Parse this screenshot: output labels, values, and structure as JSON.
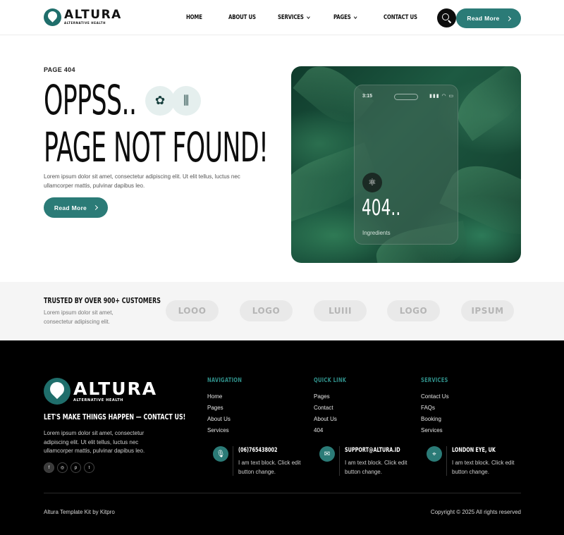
{
  "brand": {
    "name": "ALTURA",
    "tagline": "ALTERNATIVE HEALTH"
  },
  "nav": {
    "items": [
      {
        "label": "HOME",
        "has_dropdown": false
      },
      {
        "label": "ABOUT US",
        "has_dropdown": false
      },
      {
        "label": "SERVICES",
        "has_dropdown": true
      },
      {
        "label": "PAGES",
        "has_dropdown": true
      },
      {
        "label": "CONTACT US",
        "has_dropdown": false
      }
    ],
    "cta_label": "Read More",
    "search_icon": "search-icon"
  },
  "hero": {
    "eyebrow": "PAGE 404",
    "headline_line1": "OPPSS..",
    "headline_line2": "PAGE NOT FOUND!",
    "body": "Lorem ipsum dolor sit amet, consectetur adipiscing elit. Ut elit tellus, luctus nec ullamcorper mattis, pulvinar dapibus leo.",
    "cta_label": "Read More",
    "icons": [
      "flower-icon",
      "bamboo-icon"
    ]
  },
  "phone_card": {
    "time": "3:15",
    "status": "▮▮▮ ◠ ▭",
    "big_text": "404..",
    "caption": "Ingredients",
    "icon": "atom-icon"
  },
  "trusted": {
    "title": "TRUSTED BY OVER 900+ CUSTOMERS",
    "text": "Lorem ipsum dolor sit amet, consectetur adipiscing elit.",
    "partners": [
      "LOOO",
      "LOGO",
      "LUIII",
      "LOGO",
      "IPSUM"
    ]
  },
  "footer": {
    "brand_name": "ALTURA",
    "brand_sub": "ALTERNATIVE HEALTH",
    "tagline": "LET'S MAKE THINGS HAPPEN — CONTACT US!",
    "text": "Lorem ipsum dolor sit amet, consectetur adipiscing elit. Ut elit tellus, luctus nec ullamcorper mattis, pulvinar dapibus leo.",
    "socials": [
      {
        "icon": "facebook-icon",
        "glyph": "f"
      },
      {
        "icon": "instagram-icon",
        "glyph": "◎"
      },
      {
        "icon": "pinterest-icon",
        "glyph": "p"
      },
      {
        "icon": "twitter-icon",
        "glyph": "t"
      }
    ],
    "columns": [
      {
        "title": "NAVIGATION",
        "links": [
          "Home",
          "Pages",
          "About Us",
          "Services"
        ]
      },
      {
        "title": "QUICK LINK",
        "links": [
          "Pages",
          "Contact",
          "About Us",
          "404"
        ]
      },
      {
        "title": "SERVICES",
        "links": [
          "Contact Us",
          "FAQs",
          "Booking",
          "Services"
        ]
      }
    ],
    "contacts": [
      {
        "icon": "microphone-icon",
        "title": "(06)765438002",
        "text": "I am text block. Click edit button  change."
      },
      {
        "icon": "mail-icon",
        "title": "SUPPORT@ALTURA.ID",
        "text": "I am text block. Click edit button  change."
      },
      {
        "icon": "location-pin-icon",
        "title": "LONDON EYE, UK",
        "text": "I am text block. Click edit button  change."
      }
    ],
    "credit": "Altura Template Kit by Kitpro",
    "copyright": "Copyright © 2025 All rights reserved"
  },
  "colors": {
    "accent": "#2b7b77",
    "dark": "#000000",
    "band": "#f5f5f5"
  }
}
